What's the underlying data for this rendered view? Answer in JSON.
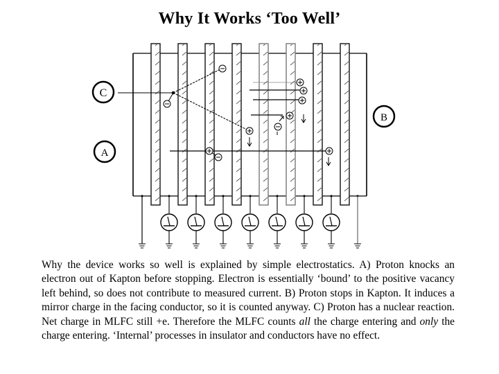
{
  "slide": {
    "title": "Why It Works ‘Too Well’"
  },
  "diagram": {
    "labels": {
      "a": "A",
      "b": "B",
      "c": "C"
    },
    "charge_symbols": {
      "positive": "+",
      "negative": "−"
    },
    "conductor_count": 8,
    "meter_count": 7,
    "ground_count": 9
  },
  "caption": {
    "part1": "Why the device works so well is explained by simple electrostatics. A) Proton knocks an electron out of Kapton before stopping. Electron is essentially ‘bound’ to the positive vacancy left behind, so does not contribute to measured current. B) Proton stops in Kapton. It induces a mirror charge in the facing conductor, so it is counted anyway. C) Proton has a nuclear reaction. Net charge in MLFC still +e. Therefore the MLFC counts ",
    "em1": "all",
    "part2": " the charge entering and ",
    "em2": "only",
    "part3": "  the charge entering. ‘Internal’ processes in insulator and conductors have no effect."
  }
}
